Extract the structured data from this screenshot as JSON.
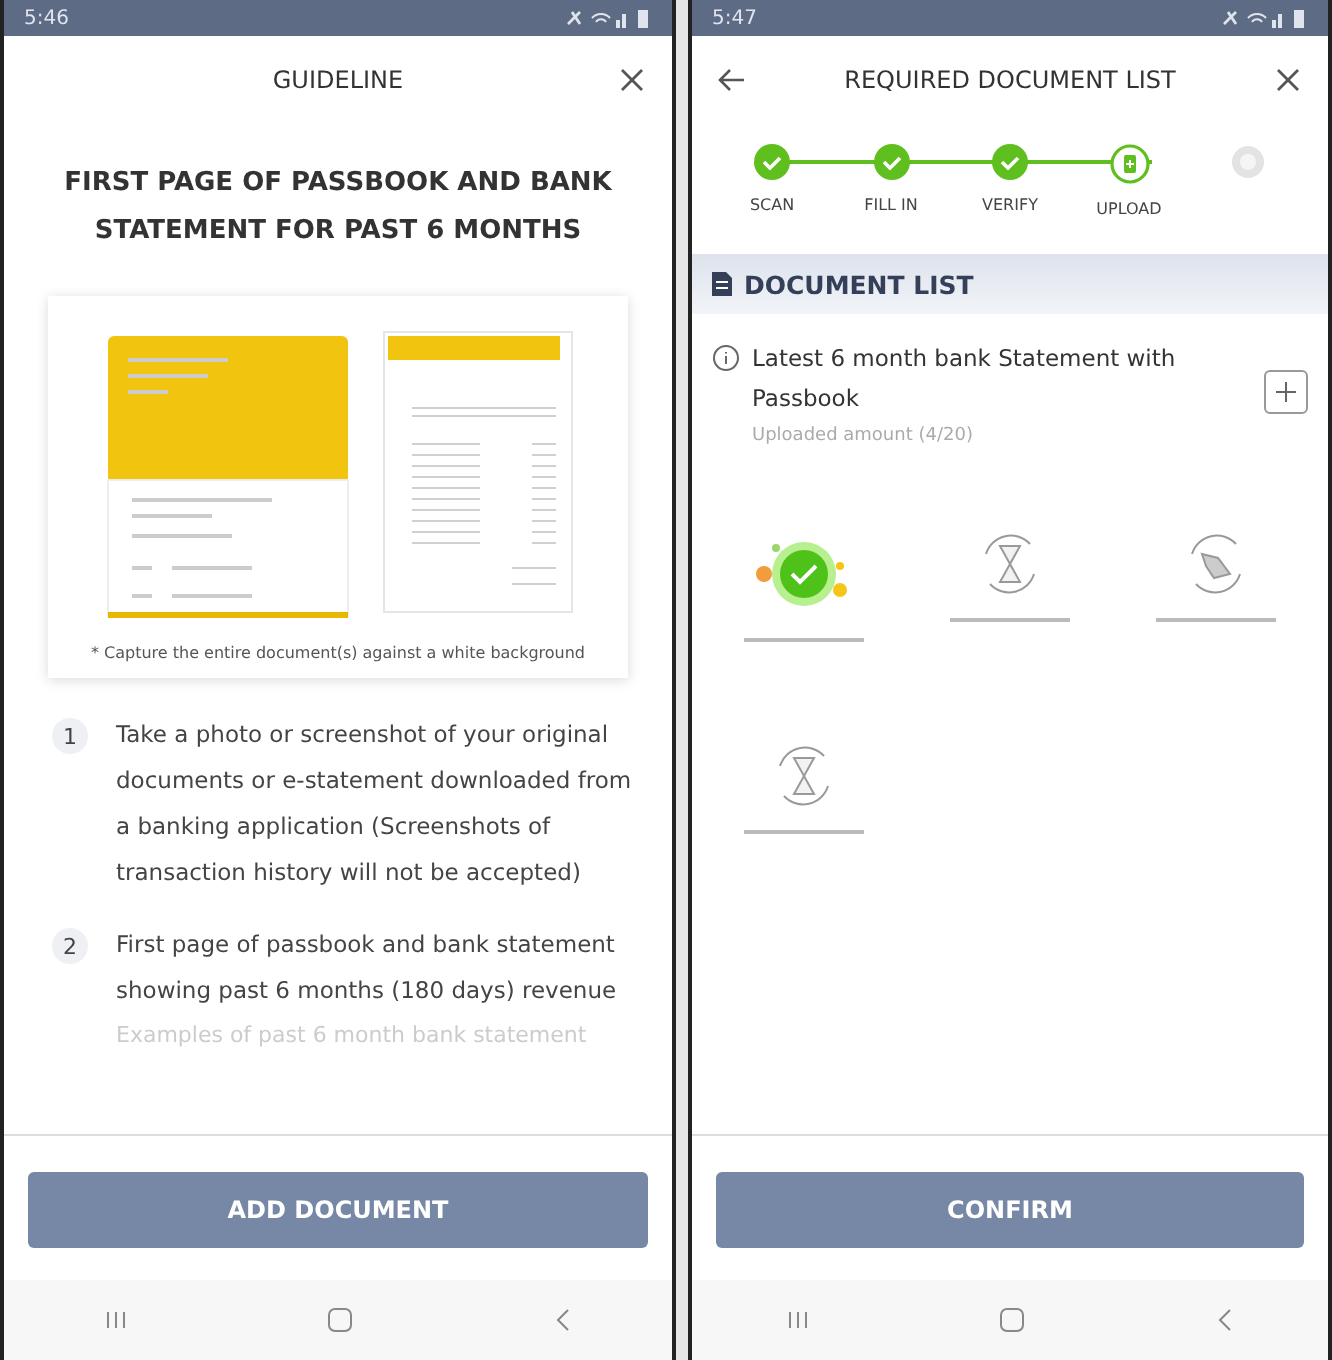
{
  "guideline_screen": {
    "status_bar": {
      "time": "5:46"
    },
    "title": "GUIDELINE",
    "heading": "FIRST PAGE OF PASSBOOK AND BANK STATEMENT FOR PAST 6 MONTHS",
    "illustration_caption": "* Capture the entire document(s) against a white background",
    "steps": [
      {
        "number": "1",
        "text": "Take a photo or screenshot of your original documents or e-statement downloaded from a banking application (Screenshots of transaction history will not be accepted)"
      },
      {
        "number": "2",
        "text": "First page of passbook and bank statement showing past 6 months (180 days) revenue"
      }
    ],
    "faded_text": "Examples of past 6 month bank statement",
    "button": "ADD DOCUMENT"
  },
  "document_screen": {
    "status_bar": {
      "time": "5:47"
    },
    "title": "REQUIRED DOCUMENT LIST",
    "steps": [
      {
        "label": "SCAN",
        "kind": "done"
      },
      {
        "label": "FILL IN",
        "kind": "done"
      },
      {
        "label": "VERIFY",
        "kind": "done"
      },
      {
        "label": "UPLOAD",
        "kind": "current"
      },
      {
        "kind": "pending"
      }
    ],
    "section_title": "DOCUMENT LIST",
    "document": {
      "name": "Latest 6 month bank Statement with Passbook",
      "uploaded": "Uploaded amount (4/20)"
    },
    "files": [
      {
        "kind": "uploaded"
      },
      {
        "kind": "waiting"
      },
      {
        "kind": "processing"
      },
      {
        "kind": "waiting"
      }
    ],
    "button": "CONFIRM"
  }
}
